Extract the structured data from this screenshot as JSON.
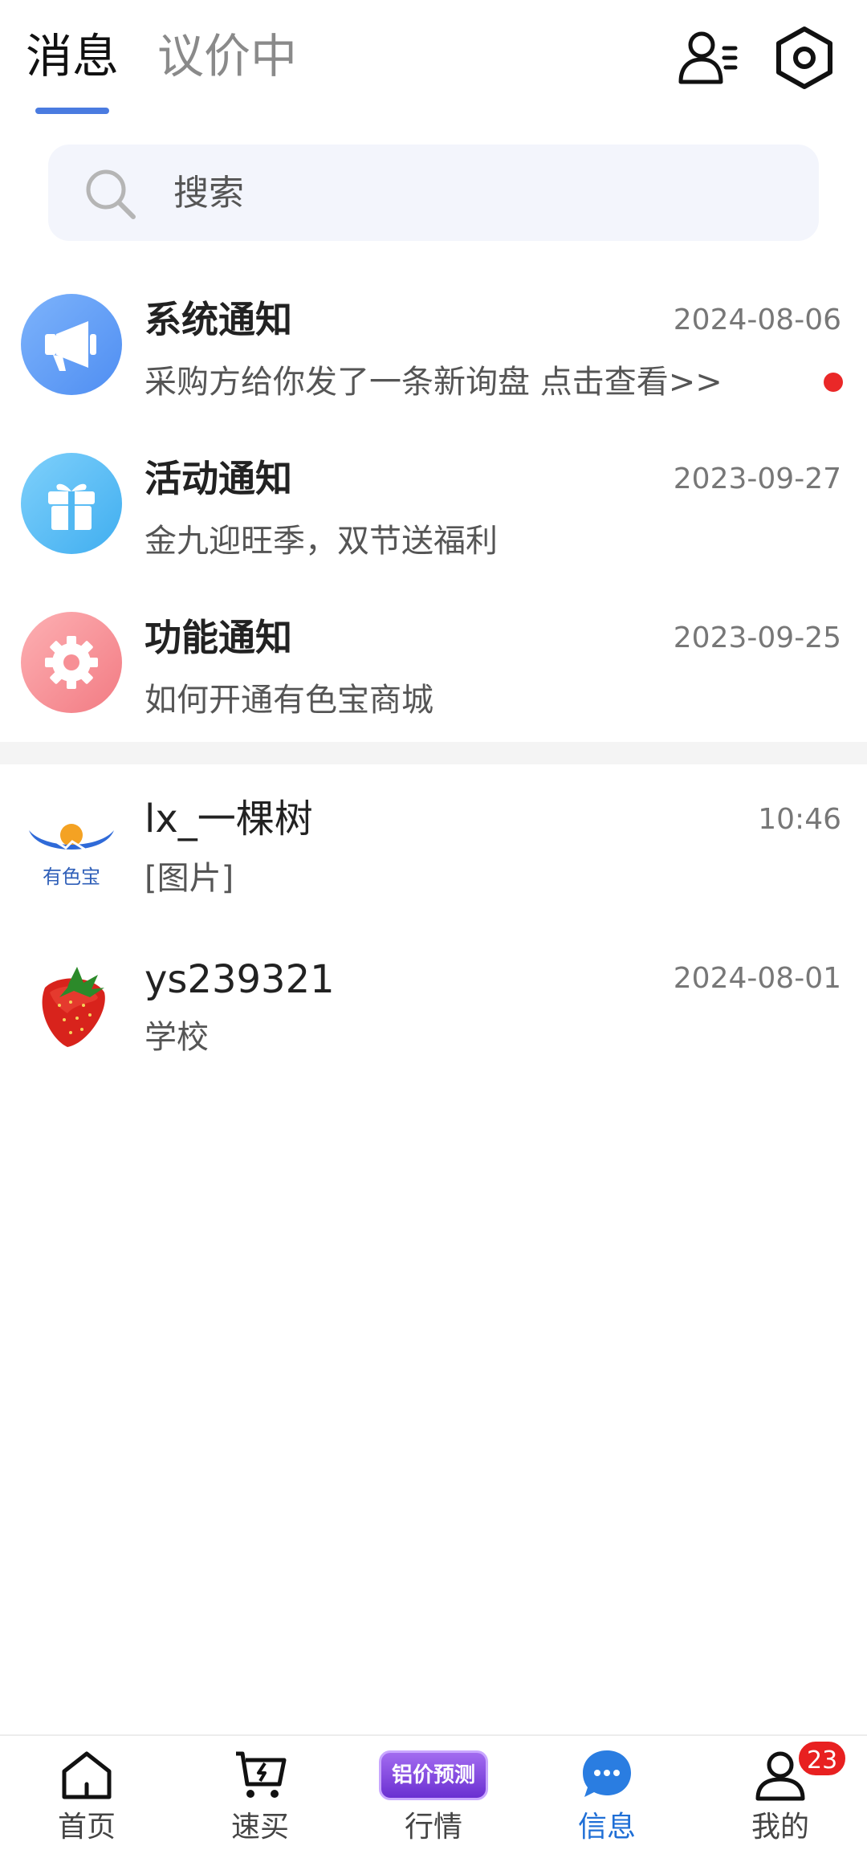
{
  "header": {
    "tabs": [
      {
        "label": "消息",
        "active": true
      },
      {
        "label": "议价中",
        "active": false
      }
    ],
    "icons": [
      "contacts-icon",
      "settings-hex-icon"
    ],
    "accent_color": "#4a7be0"
  },
  "search": {
    "placeholder": "搜索"
  },
  "notifications": [
    {
      "title": "系统通知",
      "date": "2024-08-06",
      "preview": "采购方给你发了一条新询盘  点击查看>>",
      "unread": true,
      "icon": "megaphone-icon",
      "color": "#5b9af5"
    },
    {
      "title": "活动通知",
      "date": "2023-09-27",
      "preview": "金九迎旺季，双节送福利",
      "unread": false,
      "icon": "gift-icon",
      "color": "#52b8f2"
    },
    {
      "title": "功能通知",
      "date": "2023-09-25",
      "preview": "如何开通有色宝商城",
      "unread": false,
      "icon": "gear-icon",
      "color": "#f78f95"
    }
  ],
  "chats": [
    {
      "name": "lx_一棵树",
      "time": "10:46",
      "preview": "[图片]",
      "avatar": "youse-bao-logo",
      "logo_text": "有色宝"
    },
    {
      "name": "ys239321",
      "time": "2024-08-01",
      "preview": "学校",
      "avatar": "strawberry-avatar"
    }
  ],
  "bottom_nav": {
    "items": [
      {
        "label": "首页",
        "icon": "home-icon",
        "active": false
      },
      {
        "label": "速买",
        "icon": "quick-buy-cart-icon",
        "active": false
      },
      {
        "label": "行情",
        "icon": "price-forecast-badge",
        "badge_text": "铝价预测",
        "active": false
      },
      {
        "label": "信息",
        "icon": "chat-bubble-icon",
        "active": true
      },
      {
        "label": "我的",
        "icon": "user-icon",
        "badge_count": "23",
        "active": false
      }
    ],
    "active_color": "#1f6fd6",
    "badge_color": "#e82020"
  }
}
